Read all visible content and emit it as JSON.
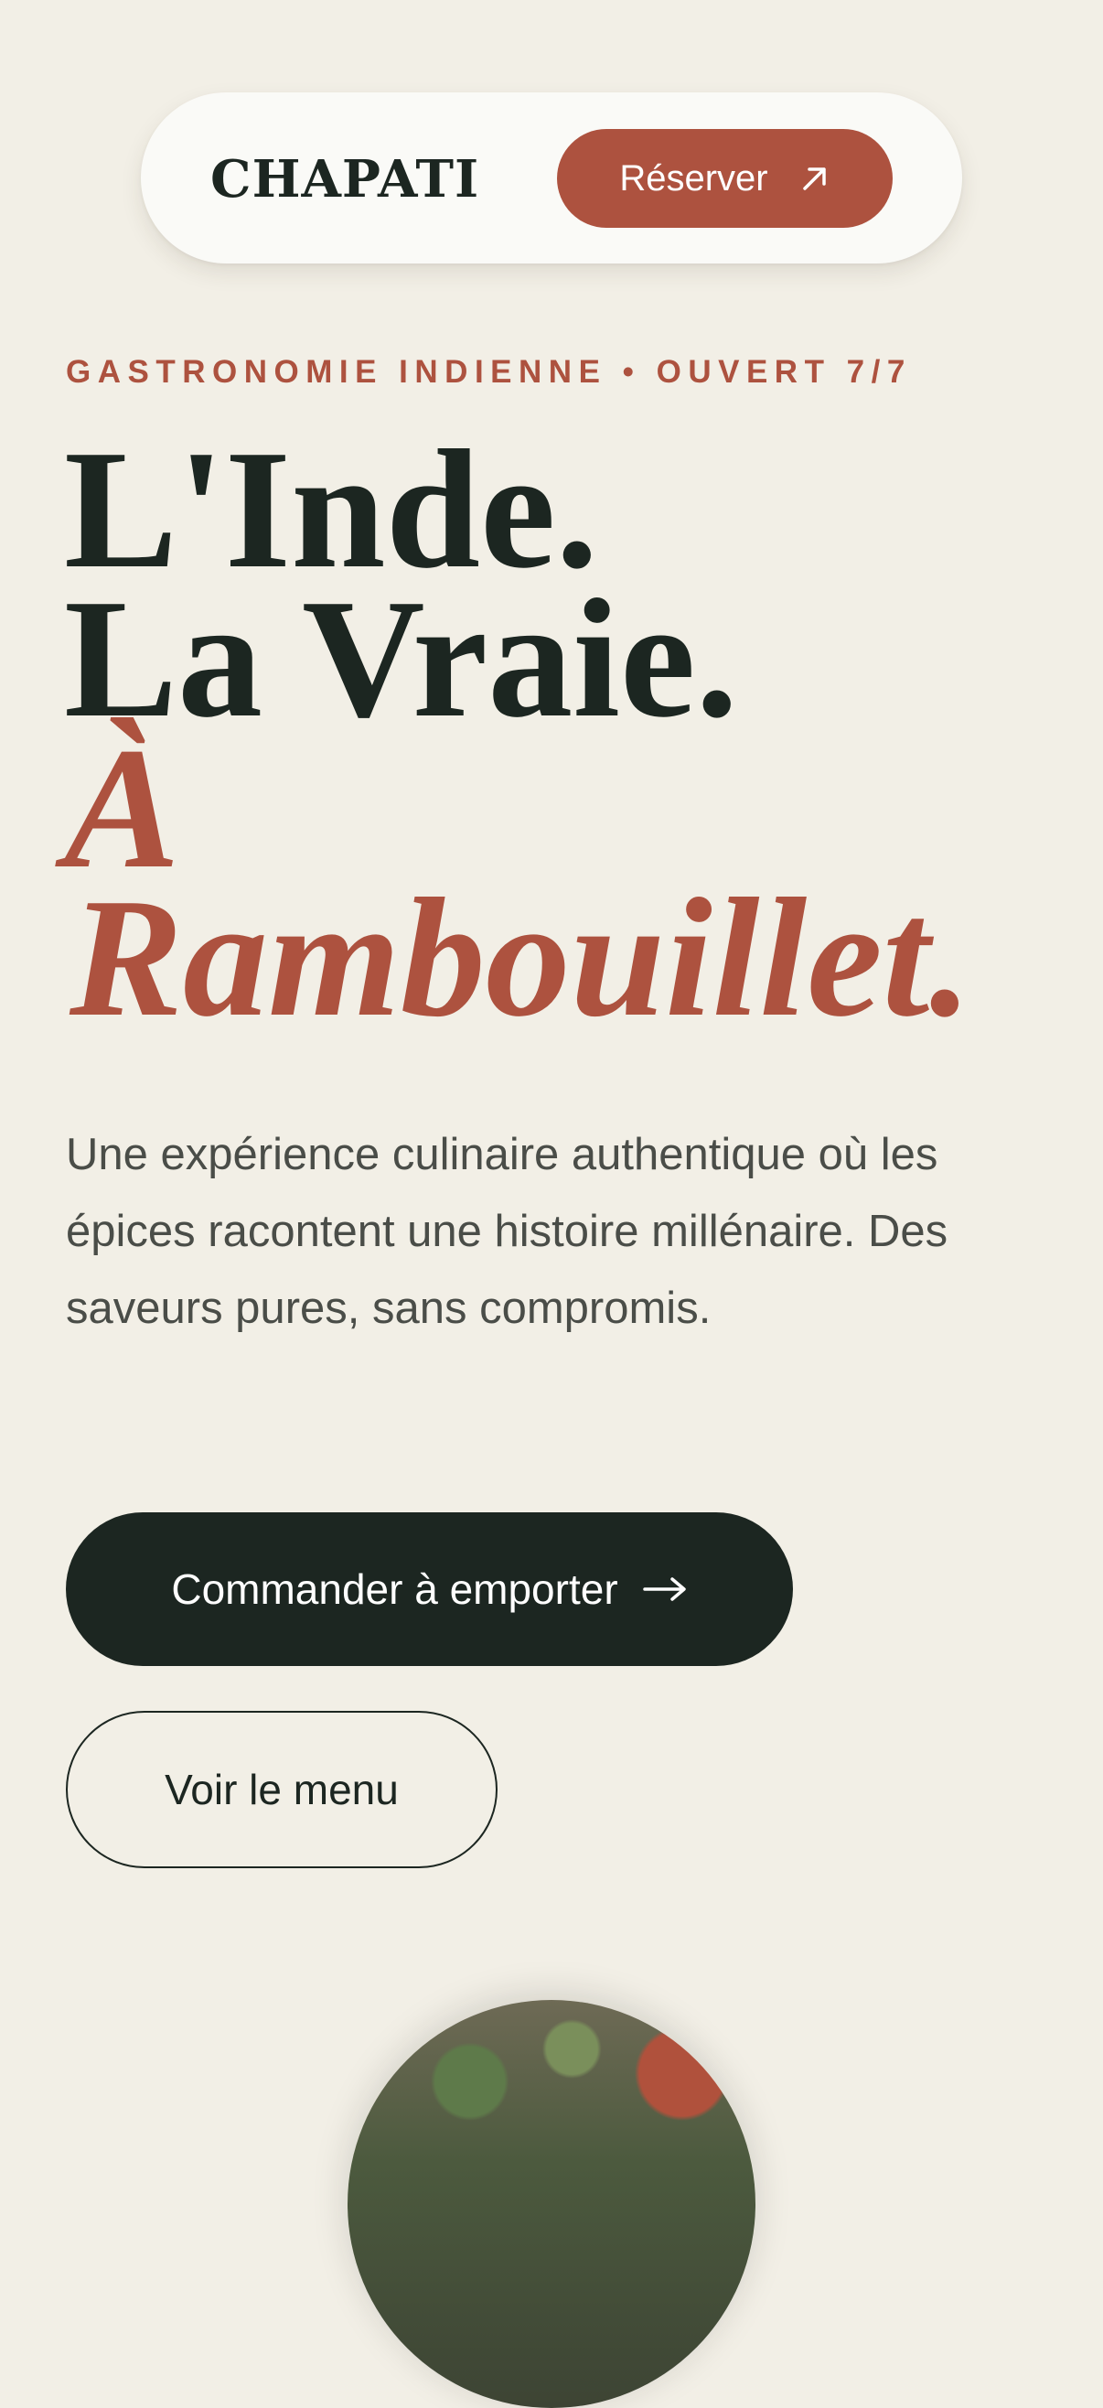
{
  "header": {
    "logo": "CHAPATI",
    "reserve_label": "Réserver",
    "reserve_icon": "arrow-up-right-icon"
  },
  "hero": {
    "eyebrow": "GASTRONOMIE INDIENNE • OUVERT 7/7",
    "title_lines": [
      "L'Inde.",
      "La Vraie.",
      "À",
      "Rambouillet."
    ],
    "description": "Une expérience culinaire authentique où les épices racontent une histoire millénaire. Des saveurs pures, sans compromis."
  },
  "actions": {
    "order_label": "Commander à emporter",
    "order_icon": "arrow-right-icon",
    "menu_label": "Voir le menu"
  },
  "colors": {
    "background": "#f2efe6",
    "accent": "#ad523f",
    "dark": "#1c2621",
    "text": "#4a4d48"
  }
}
